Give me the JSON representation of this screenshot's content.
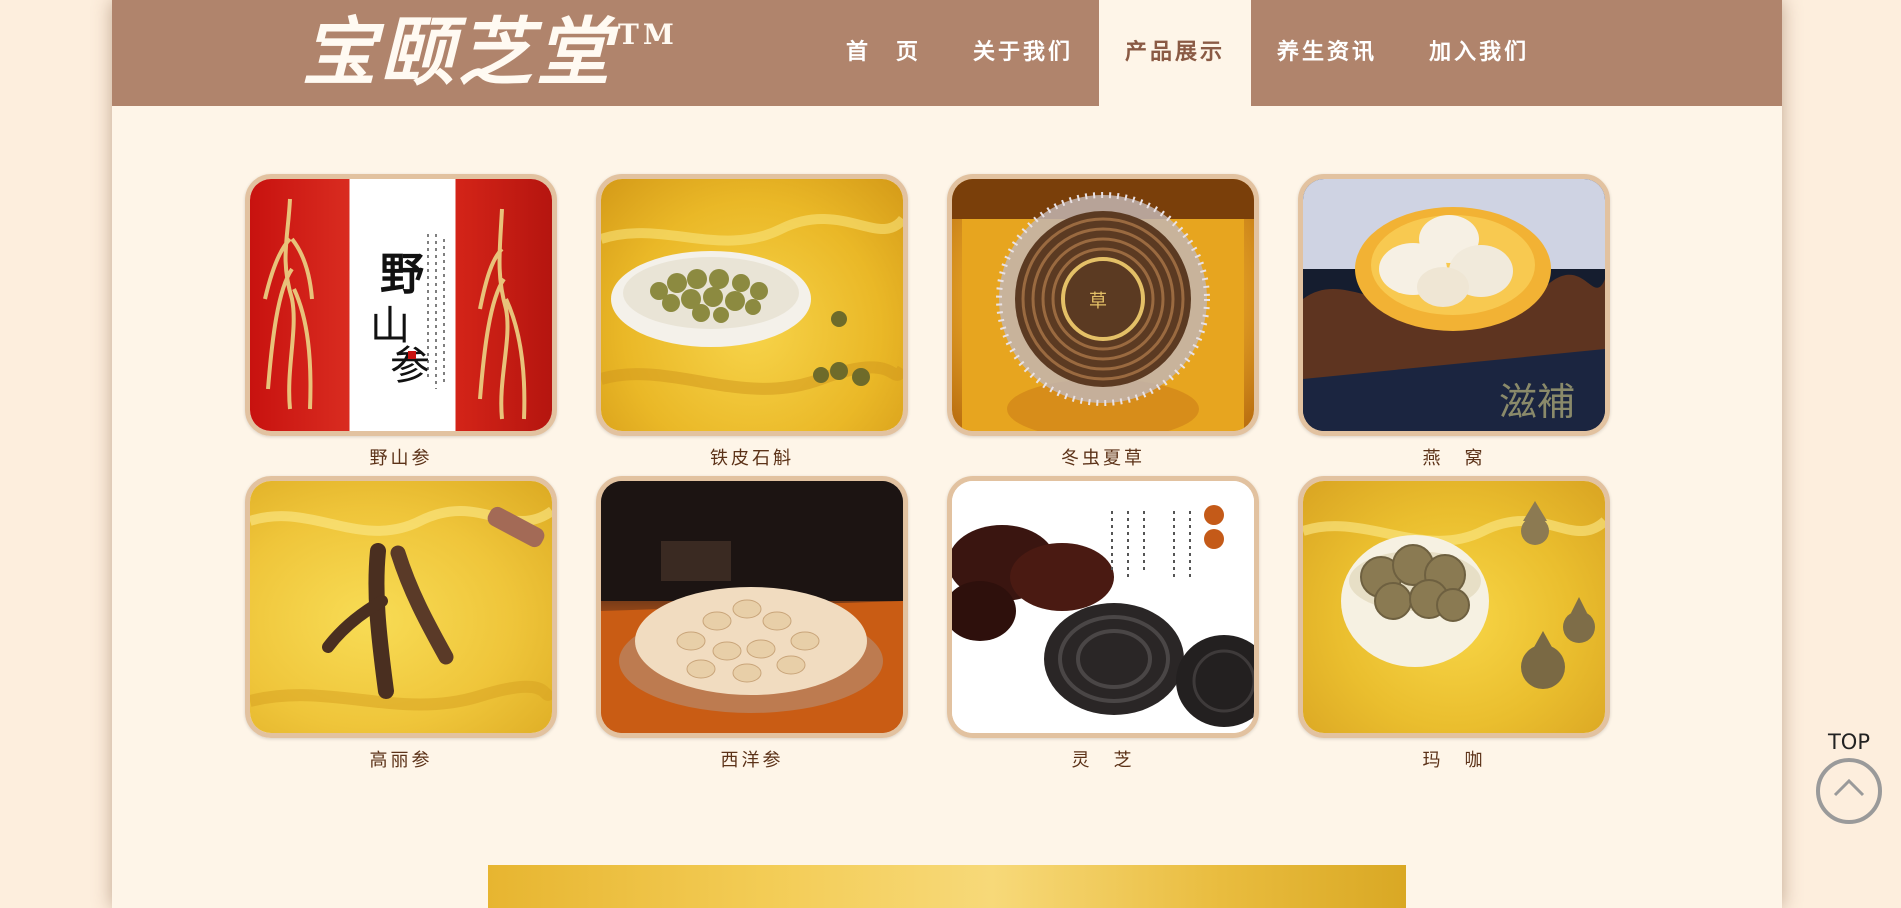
{
  "brand": {
    "logo_text": "宝颐芝堂",
    "trademark": "TM"
  },
  "nav": {
    "items": [
      {
        "label": "首　页"
      },
      {
        "label": "关于我们"
      },
      {
        "label": "产品展示"
      },
      {
        "label": "养生资讯"
      },
      {
        "label": "加入我们"
      }
    ],
    "active_index": 2
  },
  "products": [
    {
      "name": "野山参",
      "icon": "wild-ginseng-photo"
    },
    {
      "name": "铁皮石斛",
      "icon": "dendrobium-photo"
    },
    {
      "name": "冬虫夏草",
      "icon": "cordyceps-photo"
    },
    {
      "name": "燕　窝",
      "icon": "birds-nest-photo"
    },
    {
      "name": "高丽参",
      "icon": "korean-ginseng-photo"
    },
    {
      "name": "西洋参",
      "icon": "american-ginseng-photo"
    },
    {
      "name": "灵　芝",
      "icon": "lingzhi-photo"
    },
    {
      "name": "玛　咖",
      "icon": "maca-photo"
    }
  ],
  "back_to_top": {
    "label": "TOP"
  },
  "colors": {
    "header": "#b0846c",
    "page_bg": "#fef5e8",
    "frame_border": "#e2c2a0",
    "caption_text": "#5c3218"
  }
}
